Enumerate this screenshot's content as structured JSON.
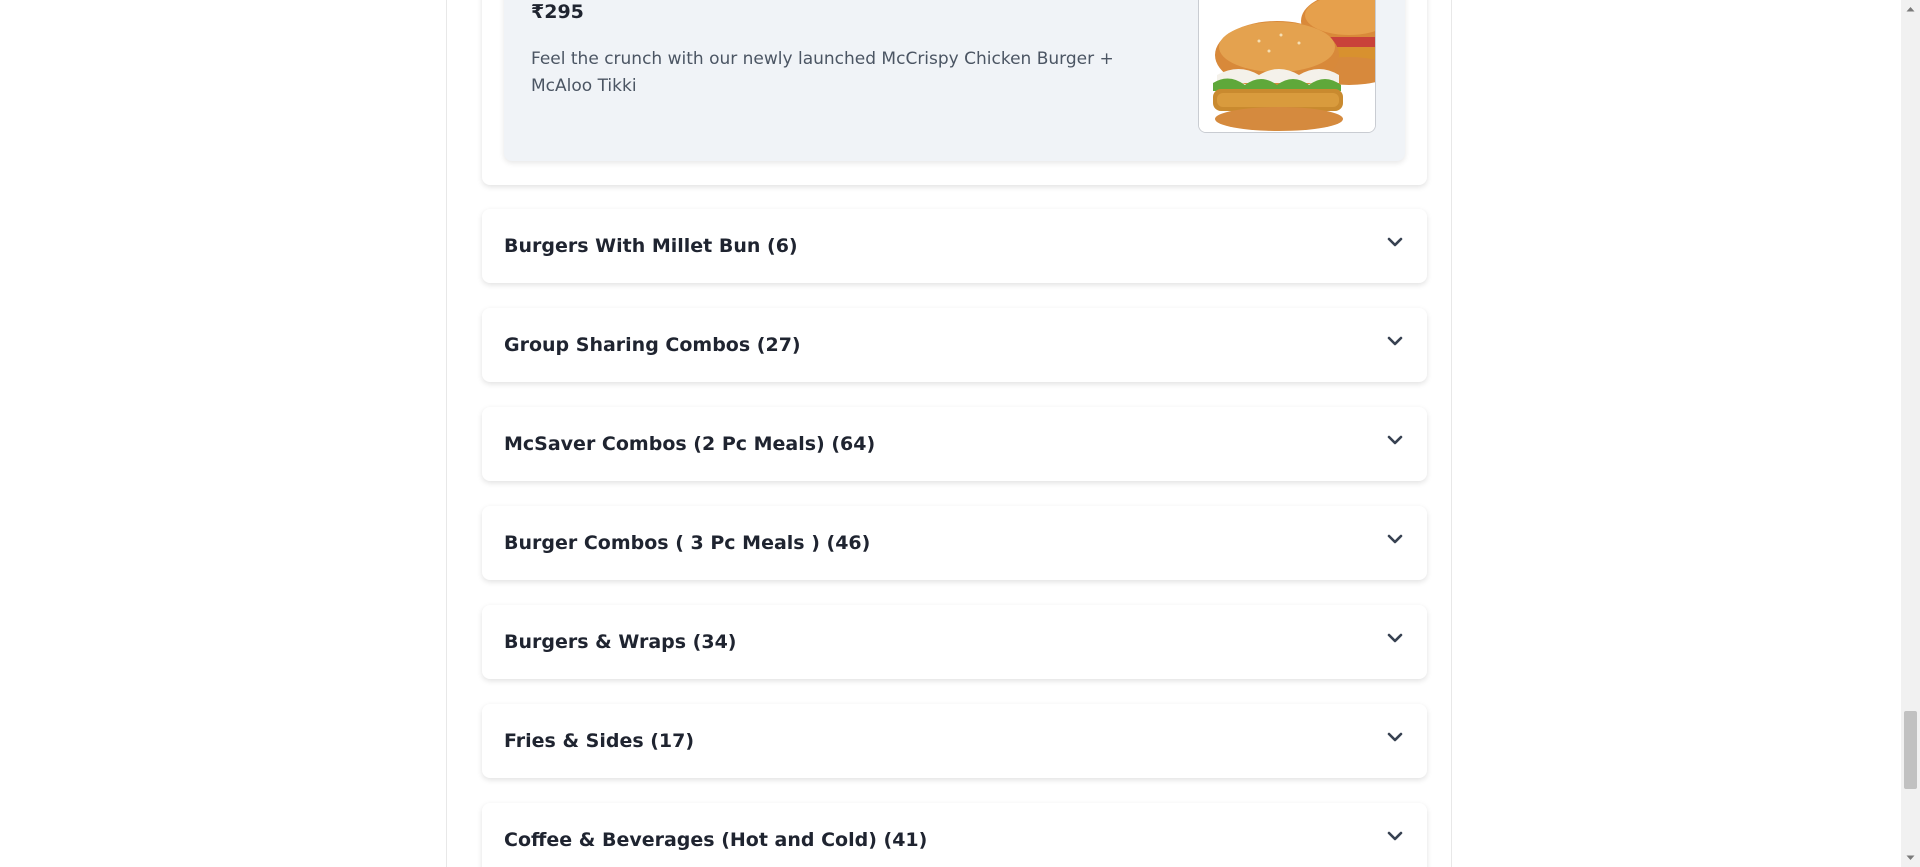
{
  "featured_item": {
    "price": "₹295",
    "description": "Feel the crunch with our newly launched McCrispy Chicken Burger + McAloo Tikki",
    "image_alt": "McCrispy Chicken Burger and McAloo Tikki"
  },
  "categories": [
    {
      "label": "Burgers With Millet Bun (6)"
    },
    {
      "label": "Group Sharing Combos (27)"
    },
    {
      "label": "McSaver Combos (2 Pc Meals) (64)"
    },
    {
      "label": "Burger Combos ( 3 Pc Meals ) (46)"
    },
    {
      "label": "Burgers & Wraps (34)"
    },
    {
      "label": "Fries & Sides (17)"
    },
    {
      "label": "Coffee & Beverages (Hot and Cold) (41)"
    }
  ],
  "icons": {
    "category_toggle": "chevron-down-icon",
    "scroll_up": "arrow-up-icon",
    "scroll_down": "arrow-down-icon"
  },
  "colors": {
    "page_background": "#ffffff",
    "item_card_background": "#f0f3f7",
    "heading_text": "#1f2430",
    "body_text": "#4b5563",
    "chevron": "#374151"
  }
}
